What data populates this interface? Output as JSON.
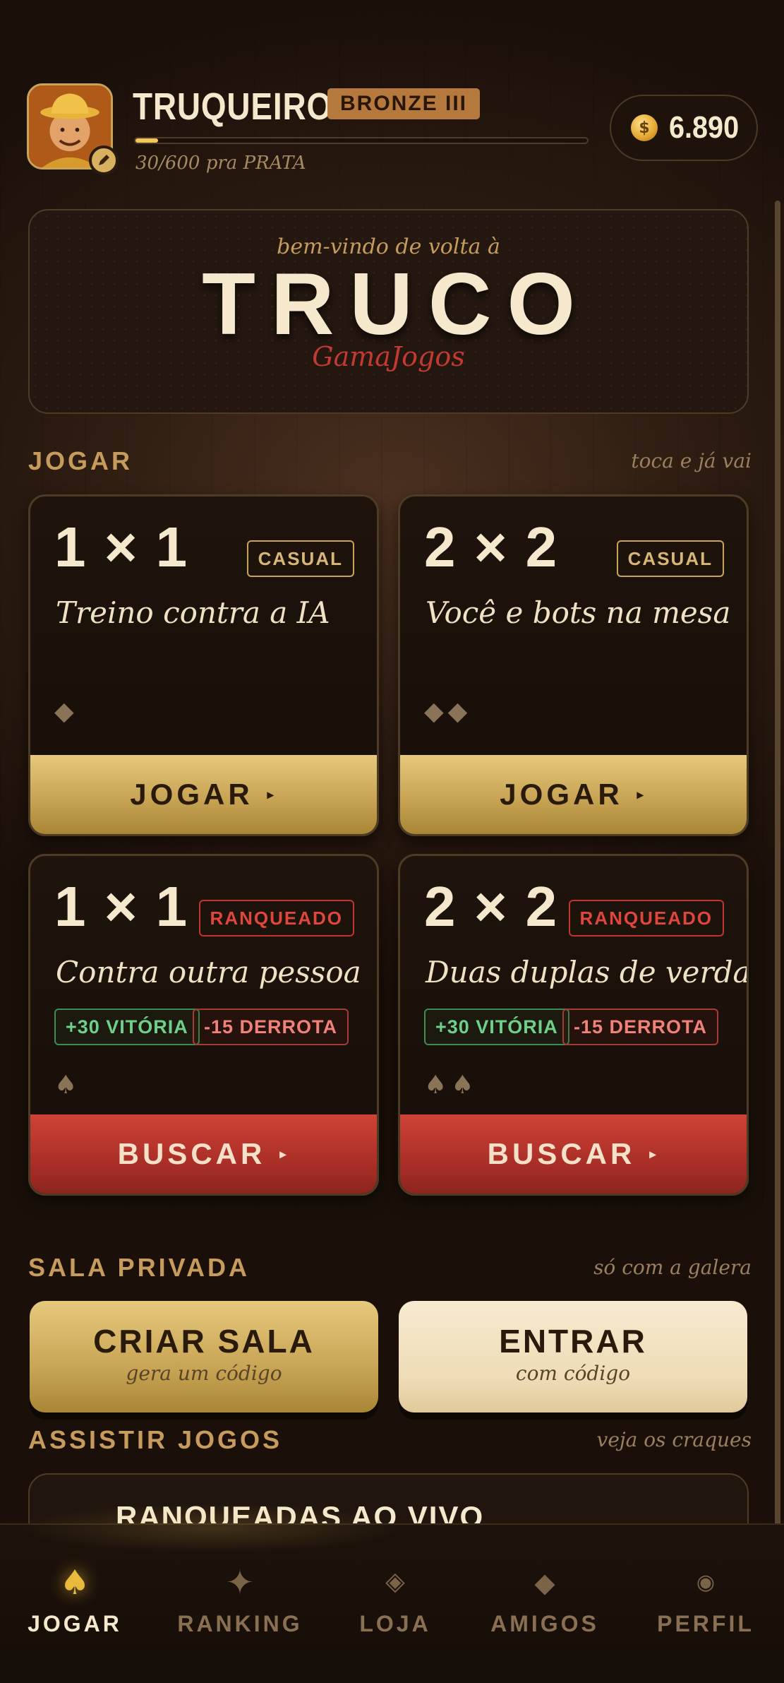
{
  "profile": {
    "username": "TRUQUEIRO",
    "rank": "BRONZE III",
    "xp_text": "30/600 pra PRATA",
    "xp_progress": 0.05,
    "coins": "6.890",
    "avatar_icon": "prospector-avatar-icon",
    "edit_icon": "pencil-icon"
  },
  "hero": {
    "welcome": "bem-vindo de volta à",
    "title": "TRUCO",
    "subtitle": "GamaJogos"
  },
  "sections": {
    "play": {
      "title": "JOGAR",
      "hint": "toca e já vai"
    },
    "private": {
      "title": "SALA PRIVADA",
      "hint": "só com a galera"
    },
    "watch": {
      "title": "ASSISTIR JOGOS",
      "hint": "veja os craques"
    }
  },
  "modes": [
    {
      "format": "1 × 1",
      "tag": "CASUAL",
      "description": "Treino contra a IA",
      "suits": "◆",
      "button": "JOGAR",
      "arrow": "▸"
    },
    {
      "format": "2 × 2",
      "tag": "CASUAL",
      "description": "Você e bots na mesa",
      "suits": "◆◆",
      "button": "JOGAR",
      "arrow": "▸"
    },
    {
      "format": "1 × 1",
      "tag": "RANQUEADO",
      "description": "Contra outra pessoa",
      "win": "+30 VITÓRIA",
      "loss": "-15 DERROTA",
      "suits": "♠",
      "button": "BUSCAR",
      "arrow": "▸"
    },
    {
      "format": "2 × 2",
      "tag": "RANQUEADO",
      "description": "Duas duplas de verdade",
      "win": "+30 VITÓRIA",
      "loss": "-15 DERROTA",
      "suits": "♠♠",
      "button": "BUSCAR",
      "arrow": "▸"
    }
  ],
  "private_room": {
    "create": {
      "title": "CRIAR SALA",
      "subtitle": "gera um código"
    },
    "join": {
      "title": "ENTRAR",
      "subtitle": "com código"
    }
  },
  "watch": {
    "live_title": "RANQUEADAS AO VIVO"
  },
  "nav": [
    {
      "label": "JOGAR",
      "glyph": "♠",
      "icon": "spade-icon",
      "active": true
    },
    {
      "label": "RANKING",
      "glyph": "✦",
      "icon": "star-icon",
      "active": false
    },
    {
      "label": "LOJA",
      "glyph": "◈",
      "icon": "diamond-outline-icon",
      "active": false
    },
    {
      "label": "AMIGOS",
      "glyph": "◆",
      "icon": "diamond-icon",
      "active": false
    },
    {
      "label": "PERFIL",
      "glyph": "◉",
      "icon": "circle-icon",
      "active": false
    }
  ],
  "colors": {
    "gold": "#c8a455",
    "red": "#aa2f27",
    "cream": "#f5e8cc",
    "win_green": "#6fd08a",
    "loss_red": "#f0827a"
  }
}
